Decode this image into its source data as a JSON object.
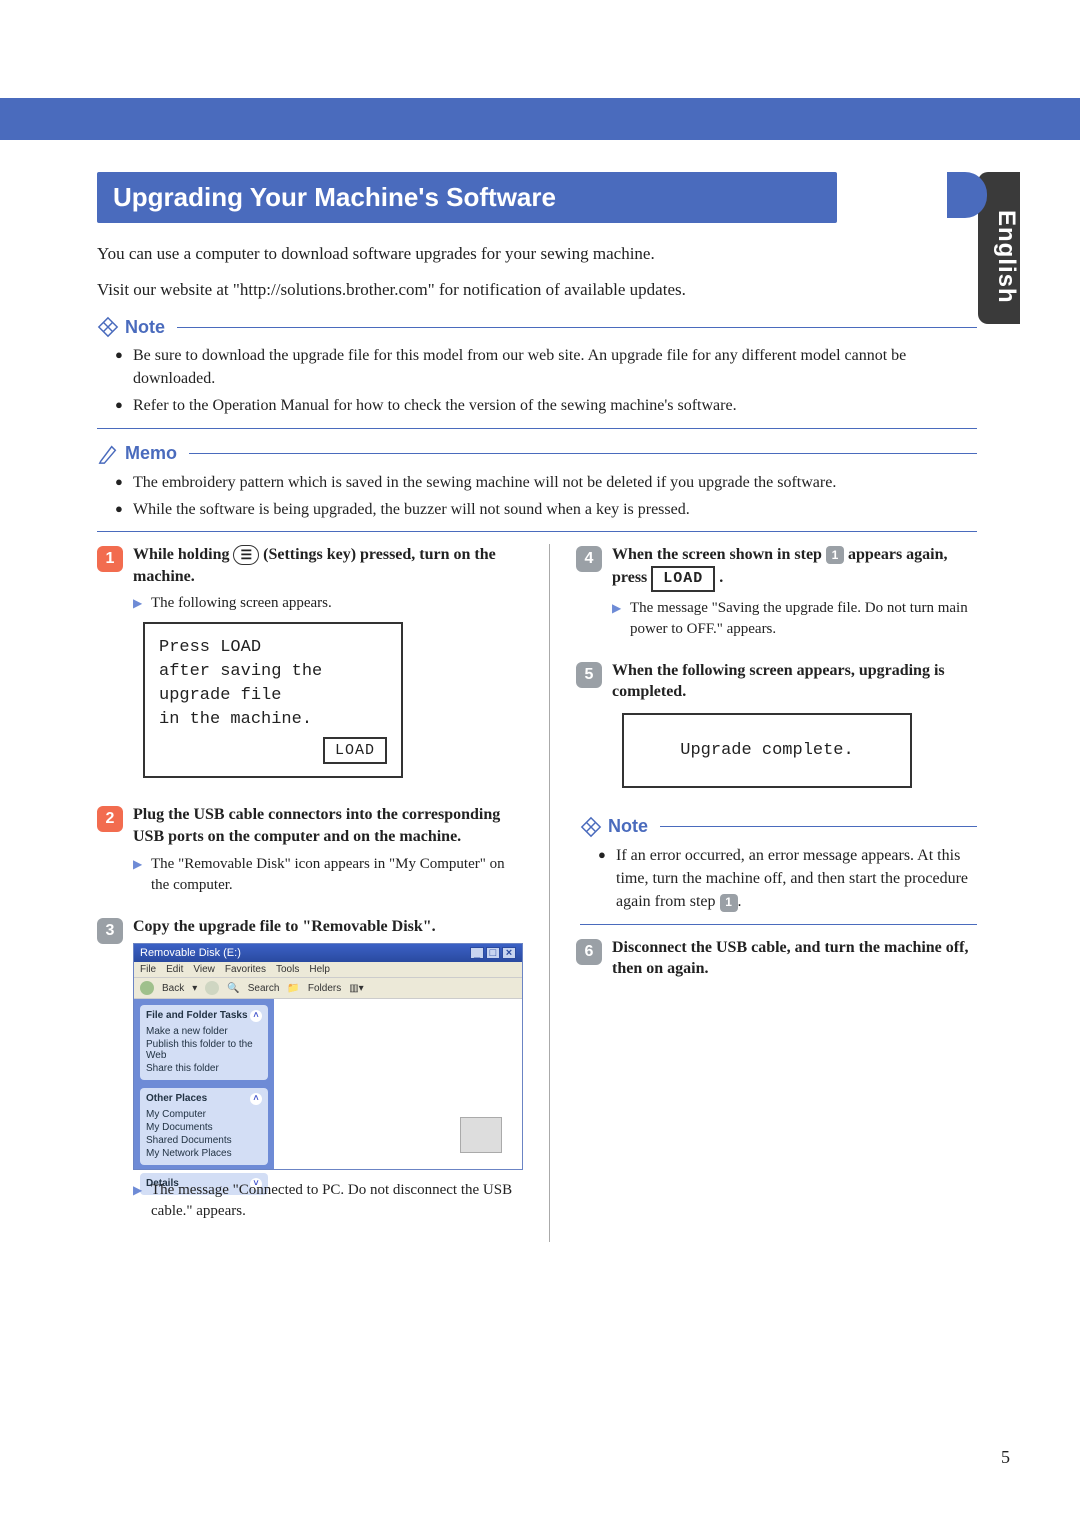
{
  "language_tab": "English",
  "page_number": "5",
  "title": "Upgrading Your Machine's Software",
  "intro_line1": "You can use a computer to download software upgrades for your sewing machine.",
  "intro_line2": "Visit our website at \"http://solutions.brother.com\" for notification of available updates.",
  "note_label": "Note",
  "memo_label": "Memo",
  "note1_items": [
    "Be sure to download the upgrade file for this model from our web site. An upgrade file for any different model cannot be downloaded.",
    "Refer to the Operation Manual for how to check the version of the sewing machine's software."
  ],
  "memo_items": [
    "The embroidery pattern which is saved in the sewing machine will not be deleted if you upgrade the software.",
    "While the software is being upgraded, the buzzer will not sound when a key is pressed."
  ],
  "steps": {
    "s1": {
      "title_pre": "While holding ",
      "title_key": "▭",
      "title_key_label": "(Settings key)",
      "title_post": " pressed, turn on the machine.",
      "sub": "The following screen appears."
    },
    "s2": {
      "title": "Plug the USB cable connectors into the corresponding USB ports on the computer and on the machine.",
      "sub": "The \"Removable Disk\" icon appears in \"My Computer\" on the computer."
    },
    "s3": {
      "title": "Copy the upgrade file to \"Removable Disk\".",
      "sub": "The message \"Connected to PC. Do not disconnect the USB cable.\" appears."
    },
    "s4": {
      "title_pre": "When the screen shown in step ",
      "title_post": " appears again, press ",
      "sub": "The message \"Saving the upgrade file. Do not turn main power to OFF.\" appears."
    },
    "s5": {
      "title": "When the following screen appears, upgrading is completed."
    },
    "s6": {
      "title": "Disconnect the USB cable, and turn the machine off, then on again."
    }
  },
  "lcd1": {
    "l1": "Press LOAD",
    "l2": "after saving the",
    "l3": "upgrade file",
    "l4": "in the machine.",
    "button": "LOAD"
  },
  "lcd2": "Upgrade complete.",
  "note2_text": "If an error occurred, an error message appears. At this time, turn the machine off, and then start the procedure again from step ",
  "note2_end": ".",
  "load_button_label": "LOAD",
  "window": {
    "title": "Removable Disk (E:)",
    "menus": [
      "File",
      "Edit",
      "View",
      "Favorites",
      "Tools",
      "Help"
    ],
    "toolbar": {
      "back": "Back",
      "search": "Search",
      "folders": "Folders"
    },
    "panel1": {
      "title": "File and Folder Tasks",
      "items": [
        "Make a new folder",
        "Publish this folder to the Web",
        "Share this folder"
      ]
    },
    "panel2": {
      "title": "Other Places",
      "items": [
        "My Computer",
        "My Documents",
        "Shared Documents",
        "My Network Places"
      ]
    },
    "panel3": {
      "title": "Details"
    }
  }
}
